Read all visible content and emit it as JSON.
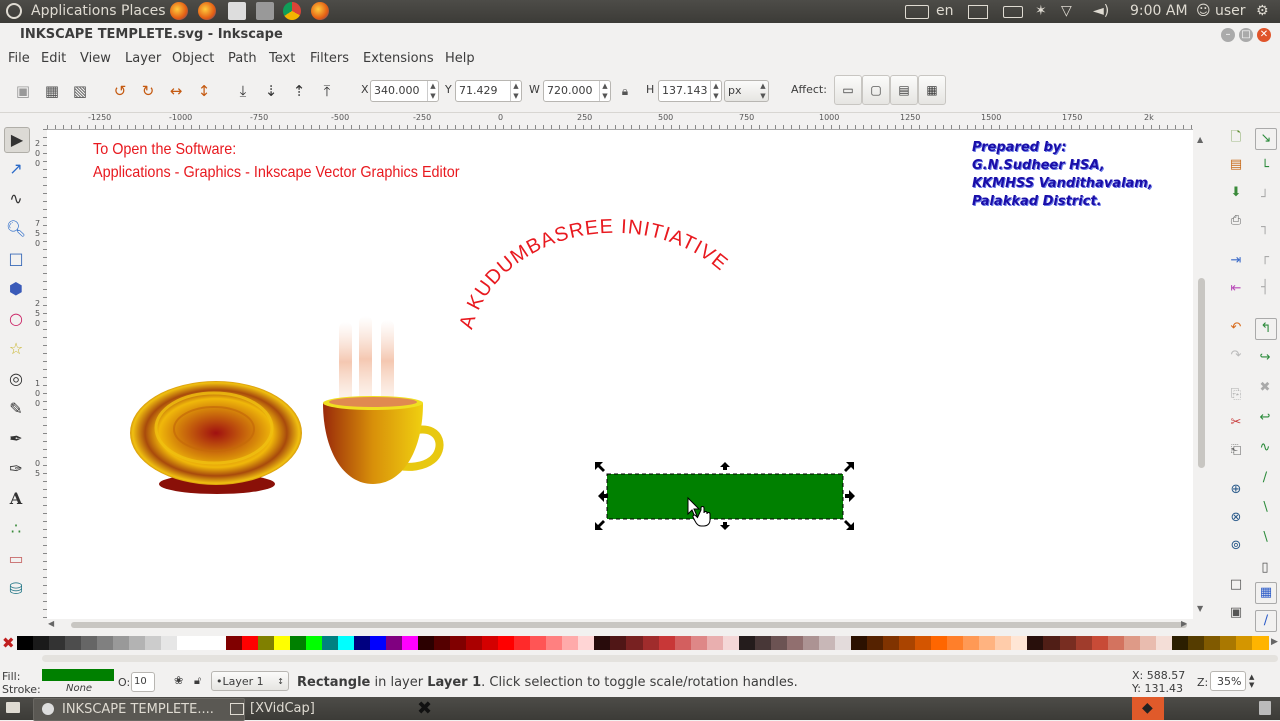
{
  "top_panel": {
    "applications": "Applications",
    "places": "Places",
    "keyboard_lang": "en",
    "clock": "9:00 AM",
    "user": "user"
  },
  "window": {
    "title": "INKSCAPE TEMPLETE.svg - Inkscape"
  },
  "menu": [
    "File",
    "Edit",
    "View",
    "Layer",
    "Object",
    "Path",
    "Text",
    "Filters",
    "Extensions",
    "Help"
  ],
  "tool_controls": {
    "x_label": "X",
    "x_value": "340.000",
    "y_label": "Y",
    "y_value": "71.429",
    "w_label": "W",
    "w_value": "720.000",
    "h_label": "H",
    "h_value": "137.143",
    "unit": "px",
    "affect_label": "Affect:"
  },
  "ruler": {
    "top_labels": [
      "-1250",
      "-1000",
      "-750",
      "-500",
      "-250",
      "0",
      "250",
      "500",
      "750",
      "1000",
      "1250",
      "1500",
      "1750",
      "2k"
    ],
    "left_labels": [
      "2",
      "0",
      "0",
      "7",
      "5",
      "0",
      "2",
      "5",
      "0",
      "1",
      "0",
      "0",
      "0",
      "5"
    ]
  },
  "canvas": {
    "open_heading": "To Open the Software:",
    "open_path": "Applications - Graphics - Inkscape Vector Graphics Editor",
    "prepared_lines": [
      "Prepared by:",
      "G.N.Sudheer HSA,",
      "KKMHSS Vandithavalam,",
      "Palakkad District."
    ],
    "arc_text": "A KUDUMBASREE INITIATIVE",
    "colors": {
      "red_text": "#e8191f",
      "prepared_text": "#1a0ea8",
      "rect_fill": "#008000"
    }
  },
  "status": {
    "fill_label": "Fill:",
    "stroke_label": "Stroke:",
    "stroke_value": "None",
    "opacity_label": "O:",
    "opacity_value": "10",
    "layer_value": "•Layer 1",
    "message_bold": "Rectangle",
    "message_mid": " in layer ",
    "message_layer": "Layer 1",
    "message_tail": ". Click selection to toggle scale/rotation handles.",
    "coord_x": "X: 588.57",
    "coord_y": "Y: 131.43",
    "zoom_label": "Z:",
    "zoom_value": "35%"
  },
  "taskbar": {
    "task1": "INKSCAPE TEMPLETE....",
    "task2": "[XVidCap]"
  },
  "palette": [
    "#000000",
    "#1a1a1a",
    "#333333",
    "#4d4d4d",
    "#666666",
    "#808080",
    "#999999",
    "#b3b3b3",
    "#cccccc",
    "#e6e6e6",
    "#ffffff",
    "#ffffff",
    "#ffffff",
    "#800000",
    "#ff0000",
    "#808000",
    "#ffff00",
    "#008000",
    "#00ff00",
    "#008080",
    "#00ffff",
    "#000080",
    "#0000ff",
    "#800080",
    "#ff00ff",
    "#2b0000",
    "#550000",
    "#800000",
    "#aa0000",
    "#d40000",
    "#ff0000",
    "#ff2a2a",
    "#ff5555",
    "#ff8080",
    "#ffaaaa",
    "#ffd5d5",
    "#280b0b",
    "#501616",
    "#782121",
    "#a02c2c",
    "#c83737",
    "#d35f5f",
    "#de8787",
    "#e9afaf",
    "#f4d7d7",
    "#241c1c",
    "#483737",
    "#6c5353",
    "#916f6f",
    "#ac9393",
    "#c8b7b7",
    "#e3dbdb",
    "#2b1100",
    "#552200",
    "#803300",
    "#aa4400",
    "#d45500",
    "#ff6600",
    "#ff7f2a",
    "#ff9955",
    "#ffb380",
    "#ffccaa",
    "#ffe6d5",
    "#280f0b",
    "#501e16",
    "#782d21",
    "#a03c2c",
    "#c84b37",
    "#d3735f",
    "#de9a87",
    "#e9bcaf",
    "#f4ded7",
    "#2b1e00",
    "#553c00",
    "#805a00",
    "#aa7800",
    "#d49600",
    "#ffb400"
  ]
}
